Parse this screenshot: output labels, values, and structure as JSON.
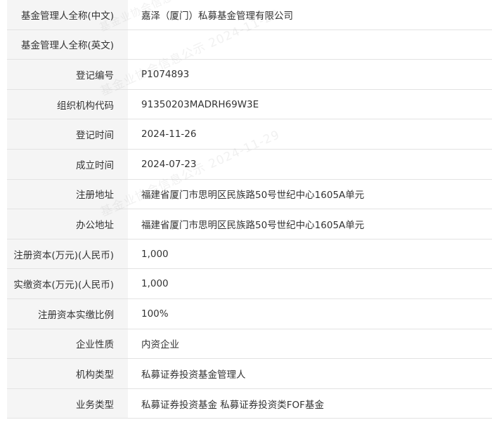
{
  "rows": [
    {
      "label": "基金管理人全称(中文)",
      "value": "嘉泽（厦门）私募基金管理有限公司"
    },
    {
      "label": "基金管理人全称(英文)",
      "value": ""
    },
    {
      "label": "登记编号",
      "value": "P1074893"
    },
    {
      "label": "组织机构代码",
      "value": "91350203MADRH69W3E"
    },
    {
      "label": "登记时间",
      "value": "2024-11-26"
    },
    {
      "label": "成立时间",
      "value": "2024-07-23"
    },
    {
      "label": "注册地址",
      "value": "福建省厦门市思明区民族路50号世纪中心1605A单元"
    },
    {
      "label": "办公地址",
      "value": "福建省厦门市思明区民族路50号世纪中心1605A单元"
    },
    {
      "label": "注册资本(万元)(人民币)",
      "value": "1,000"
    },
    {
      "label": "实缴资本(万元)(人民币)",
      "value": "1,000"
    },
    {
      "label": "注册资本实缴比例",
      "value": "100%"
    },
    {
      "label": "企业性质",
      "value": "内资企业"
    },
    {
      "label": "机构类型",
      "value": "私募证券投资基金管理人"
    },
    {
      "label": "业务类型",
      "value": "私募证券投资基金  私募证券投资类FOF基金"
    }
  ],
  "watermark": {
    "text1": "基金业协会信息公示 2024-11-29",
    "text2": "基金业协会信息公示 2024-11-29",
    "text3": "基金业协会信息公示"
  }
}
